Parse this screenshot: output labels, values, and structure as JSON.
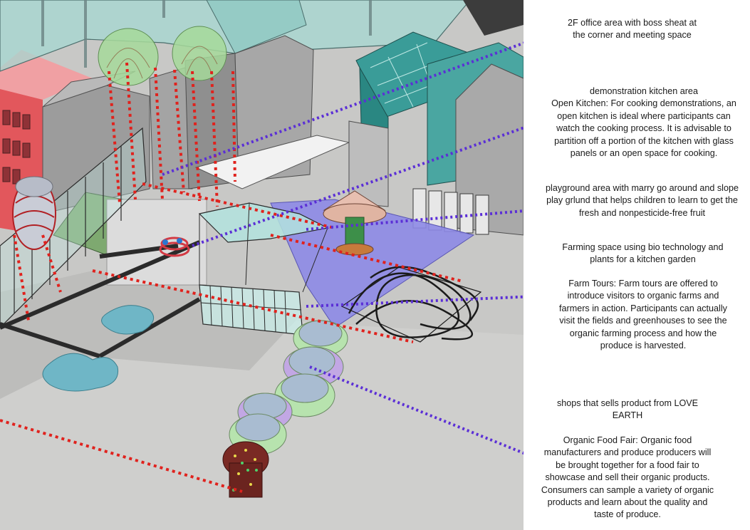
{
  "colors": {
    "ground": "#c8c8c6",
    "wall_gray": "#9c9c9c",
    "glass": "#9fd3cf",
    "glass_teal": "#2f8c88",
    "red_facade": "#e2575c",
    "blue_floor": "#8d89e6",
    "pond": "#6fb6c6",
    "leader_purple": "#5b2fd6",
    "leader_red": "#e0221d",
    "bubble_green": "#b7e3ae",
    "bubble_purple": "#c2a7e4",
    "bubble_dome": "#a9bcd1"
  },
  "annotations": [
    {
      "id": "office",
      "lines": [
        "2F office area with boss sheat at",
        "the corner and meeting space"
      ]
    },
    {
      "id": "kitchen",
      "lines": [
        "demonstration kitchen area",
        "Open Kitchen: For cooking demonstrations, an",
        "open kitchen is ideal where participants can",
        "watch the cooking process. It is advisable to",
        "partition off a portion of the kitchen with glass",
        "panels or an open space for cooking."
      ]
    },
    {
      "id": "playground",
      "lines": [
        "playground area with marry go around and slope",
        "play grlund that helps children to learn to get the",
        "fresh and nonpesticide-free fruit"
      ]
    },
    {
      "id": "farming",
      "lines": [
        "Farming space using bio technology and",
        "plants for a kitchen garden"
      ]
    },
    {
      "id": "tours",
      "lines": [
        "Farm Tours: Farm tours are offered to",
        "introduce visitors to organic farms and",
        "farmers in action. Participants can actually",
        "visit the fields and greenhouses to see the",
        "organic farming process and how the",
        "produce is harvested."
      ]
    },
    {
      "id": "shops",
      "lines": [
        "shops that sells product from LOVE",
        "EARTH"
      ]
    },
    {
      "id": "fair",
      "lines": [
        "Organic Food Fair: Organic food",
        "manufacturers and produce producers will",
        "be brought together for a food fair to",
        "showcase and sell their organic products.",
        "Consumers can sample a variety of organic",
        "products and learn about the quality and",
        "taste of produce."
      ]
    }
  ]
}
